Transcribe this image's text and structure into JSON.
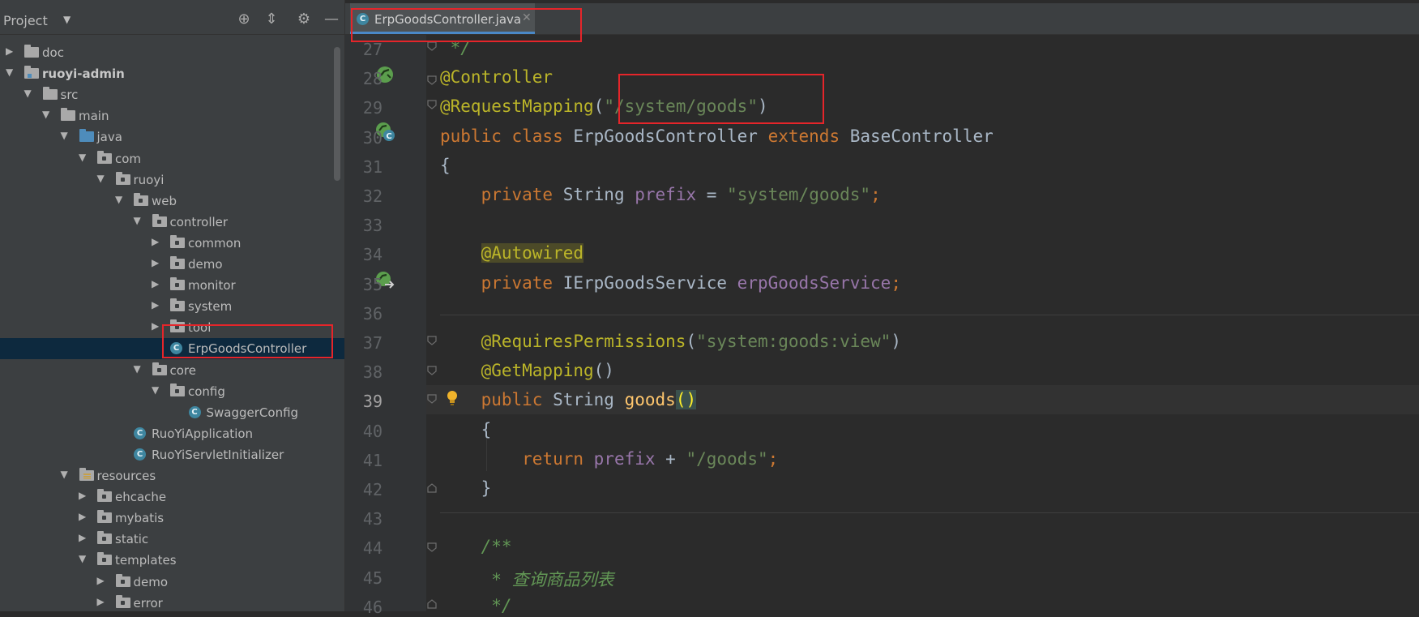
{
  "project_panel": {
    "title": "Project",
    "tree": [
      {
        "label": "doc",
        "depth": 0,
        "icon": "folder-icon",
        "expand": "collapsed"
      },
      {
        "label": "ruoyi-admin",
        "depth": 0,
        "icon": "module-folder-icon",
        "expand": "expanded",
        "bold": true
      },
      {
        "label": "src",
        "depth": 1,
        "icon": "folder-icon",
        "expand": "expanded"
      },
      {
        "label": "main",
        "depth": 2,
        "icon": "folder-icon",
        "expand": "expanded"
      },
      {
        "label": "java",
        "depth": 3,
        "icon": "source-folder-icon",
        "expand": "expanded"
      },
      {
        "label": "com",
        "depth": 4,
        "icon": "package-icon",
        "expand": "expanded"
      },
      {
        "label": "ruoyi",
        "depth": 5,
        "icon": "package-icon",
        "expand": "expanded"
      },
      {
        "label": "web",
        "depth": 6,
        "icon": "package-icon",
        "expand": "expanded"
      },
      {
        "label": "controller",
        "depth": 7,
        "icon": "package-icon",
        "expand": "expanded"
      },
      {
        "label": "common",
        "depth": 8,
        "icon": "package-icon",
        "expand": "collapsed"
      },
      {
        "label": "demo",
        "depth": 8,
        "icon": "package-icon",
        "expand": "collapsed"
      },
      {
        "label": "monitor",
        "depth": 8,
        "icon": "package-icon",
        "expand": "collapsed"
      },
      {
        "label": "system",
        "depth": 8,
        "icon": "package-icon",
        "expand": "collapsed"
      },
      {
        "label": "tool",
        "depth": 8,
        "icon": "package-icon",
        "expand": "collapsed"
      },
      {
        "label": "ErpGoodsController",
        "depth": 8,
        "icon": "java-class-icon",
        "expand": "none",
        "selected": true
      },
      {
        "label": "core",
        "depth": 7,
        "icon": "package-icon",
        "expand": "expanded"
      },
      {
        "label": "config",
        "depth": 8,
        "icon": "package-icon",
        "expand": "expanded"
      },
      {
        "label": "SwaggerConfig",
        "depth": 9,
        "icon": "java-class-icon",
        "expand": "none"
      },
      {
        "label": "RuoYiApplication",
        "depth": 6,
        "icon": "java-app-class-icon",
        "expand": "none"
      },
      {
        "label": "RuoYiServletInitializer",
        "depth": 6,
        "icon": "java-class-icon",
        "expand": "none"
      },
      {
        "label": "resources",
        "depth": 3,
        "icon": "resources-folder-icon",
        "expand": "expanded"
      },
      {
        "label": "ehcache",
        "depth": 4,
        "icon": "package-icon",
        "expand": "collapsed"
      },
      {
        "label": "mybatis",
        "depth": 4,
        "icon": "package-icon",
        "expand": "collapsed"
      },
      {
        "label": "static",
        "depth": 4,
        "icon": "package-icon",
        "expand": "collapsed"
      },
      {
        "label": "templates",
        "depth": 4,
        "icon": "package-icon",
        "expand": "expanded"
      },
      {
        "label": "demo",
        "depth": 5,
        "icon": "package-icon",
        "expand": "collapsed"
      },
      {
        "label": "error",
        "depth": 5,
        "icon": "package-icon",
        "expand": "collapsed"
      }
    ]
  },
  "editor": {
    "tab_label": "ErpGoodsController.java",
    "current_line": 39,
    "lines": [
      {
        "n": 27,
        "tokens": [
          {
            "t": " */",
            "c": "cm"
          }
        ]
      },
      {
        "n": 28,
        "tokens": [
          {
            "t": "@Controller",
            "c": "an"
          }
        ]
      },
      {
        "n": 29,
        "tokens": [
          {
            "t": "@RequestMapping",
            "c": "an"
          },
          {
            "t": "(",
            "c": ""
          },
          {
            "t": "\"/system/goods\"",
            "c": "s"
          },
          {
            "t": ")",
            "c": ""
          }
        ]
      },
      {
        "n": 30,
        "tokens": [
          {
            "t": "public class ",
            "c": "k"
          },
          {
            "t": "ErpGoodsController ",
            "c": ""
          },
          {
            "t": "extends ",
            "c": "k"
          },
          {
            "t": "BaseController",
            "c": ""
          }
        ]
      },
      {
        "n": 31,
        "tokens": [
          {
            "t": "{",
            "c": ""
          }
        ]
      },
      {
        "n": 32,
        "tokens": [
          {
            "t": "    ",
            "c": ""
          },
          {
            "t": "private ",
            "c": "k"
          },
          {
            "t": "String ",
            "c": ""
          },
          {
            "t": "prefix",
            "c": "f"
          },
          {
            "t": " = ",
            "c": ""
          },
          {
            "t": "\"system/goods\"",
            "c": "s"
          },
          {
            "t": ";",
            "c": "k"
          }
        ]
      },
      {
        "n": 33,
        "tokens": []
      },
      {
        "n": 34,
        "tokens": [
          {
            "t": "    ",
            "c": ""
          },
          {
            "t": "@Autowired",
            "c": "an autow"
          }
        ]
      },
      {
        "n": 35,
        "tokens": [
          {
            "t": "    ",
            "c": ""
          },
          {
            "t": "private ",
            "c": "k"
          },
          {
            "t": "IErpGoodsService ",
            "c": ""
          },
          {
            "t": "erpGoodsService",
            "c": "f"
          },
          {
            "t": ";",
            "c": "k"
          }
        ]
      },
      {
        "n": 36,
        "tokens": []
      },
      {
        "n": 37,
        "tokens": [
          {
            "t": "    ",
            "c": ""
          },
          {
            "t": "@RequiresPermissions",
            "c": "an"
          },
          {
            "t": "(",
            "c": ""
          },
          {
            "t": "\"system:goods:view\"",
            "c": "s"
          },
          {
            "t": ")",
            "c": ""
          }
        ]
      },
      {
        "n": 38,
        "tokens": [
          {
            "t": "    ",
            "c": ""
          },
          {
            "t": "@GetMapping",
            "c": "an"
          },
          {
            "t": "()",
            "c": ""
          }
        ]
      },
      {
        "n": 39,
        "tokens": [
          {
            "t": "    ",
            "c": ""
          },
          {
            "t": "public ",
            "c": "k"
          },
          {
            "t": "String ",
            "c": ""
          },
          {
            "t": "goods",
            "c": "m"
          },
          {
            "t": "(",
            "c": "paren"
          },
          {
            "t": ")",
            "c": "paren"
          }
        ]
      },
      {
        "n": 40,
        "tokens": [
          {
            "t": "    {",
            "c": ""
          }
        ]
      },
      {
        "n": 41,
        "tokens": [
          {
            "t": "        ",
            "c": ""
          },
          {
            "t": "return ",
            "c": "k"
          },
          {
            "t": "prefix",
            "c": "f"
          },
          {
            "t": " + ",
            "c": ""
          },
          {
            "t": "\"/goods\"",
            "c": "s"
          },
          {
            "t": ";",
            "c": "k"
          }
        ]
      },
      {
        "n": 42,
        "tokens": [
          {
            "t": "    }",
            "c": ""
          }
        ]
      },
      {
        "n": 43,
        "tokens": []
      },
      {
        "n": 44,
        "tokens": [
          {
            "t": "    ",
            "c": ""
          },
          {
            "t": "/**",
            "c": "cm"
          }
        ]
      },
      {
        "n": 45,
        "tokens": [
          {
            "t": "     * 查询商品列表",
            "c": "cm"
          }
        ]
      },
      {
        "n": 46,
        "tokens": [
          {
            "t": "     */",
            "c": "cm"
          }
        ]
      }
    ]
  },
  "colors": {
    "editor_bg": "#2b2b2b",
    "panel_bg": "#3c3f41",
    "keyword": "#cc7832",
    "annotation": "#bbb529",
    "string": "#6a8759",
    "field": "#9876aa",
    "method": "#ffc66d",
    "highlight_box": "#e5252a"
  }
}
